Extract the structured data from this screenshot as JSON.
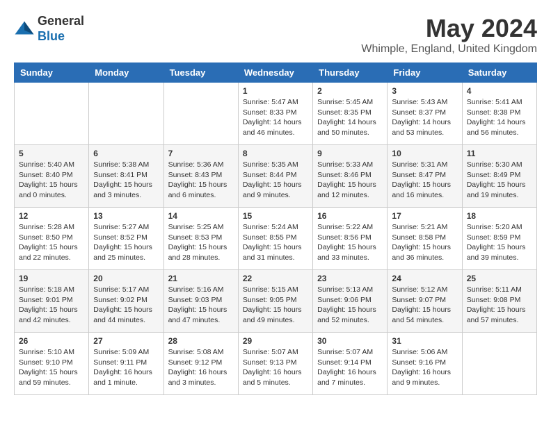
{
  "header": {
    "logo_general": "General",
    "logo_blue": "Blue",
    "month_title": "May 2024",
    "location": "Whimple, England, United Kingdom"
  },
  "days_of_week": [
    "Sunday",
    "Monday",
    "Tuesday",
    "Wednesday",
    "Thursday",
    "Friday",
    "Saturday"
  ],
  "weeks": [
    [
      {
        "day": "",
        "info": ""
      },
      {
        "day": "",
        "info": ""
      },
      {
        "day": "",
        "info": ""
      },
      {
        "day": "1",
        "info": "Sunrise: 5:47 AM\nSunset: 8:33 PM\nDaylight: 14 hours\nand 46 minutes."
      },
      {
        "day": "2",
        "info": "Sunrise: 5:45 AM\nSunset: 8:35 PM\nDaylight: 14 hours\nand 50 minutes."
      },
      {
        "day": "3",
        "info": "Sunrise: 5:43 AM\nSunset: 8:37 PM\nDaylight: 14 hours\nand 53 minutes."
      },
      {
        "day": "4",
        "info": "Sunrise: 5:41 AM\nSunset: 8:38 PM\nDaylight: 14 hours\nand 56 minutes."
      }
    ],
    [
      {
        "day": "5",
        "info": "Sunrise: 5:40 AM\nSunset: 8:40 PM\nDaylight: 15 hours\nand 0 minutes."
      },
      {
        "day": "6",
        "info": "Sunrise: 5:38 AM\nSunset: 8:41 PM\nDaylight: 15 hours\nand 3 minutes."
      },
      {
        "day": "7",
        "info": "Sunrise: 5:36 AM\nSunset: 8:43 PM\nDaylight: 15 hours\nand 6 minutes."
      },
      {
        "day": "8",
        "info": "Sunrise: 5:35 AM\nSunset: 8:44 PM\nDaylight: 15 hours\nand 9 minutes."
      },
      {
        "day": "9",
        "info": "Sunrise: 5:33 AM\nSunset: 8:46 PM\nDaylight: 15 hours\nand 12 minutes."
      },
      {
        "day": "10",
        "info": "Sunrise: 5:31 AM\nSunset: 8:47 PM\nDaylight: 15 hours\nand 16 minutes."
      },
      {
        "day": "11",
        "info": "Sunrise: 5:30 AM\nSunset: 8:49 PM\nDaylight: 15 hours\nand 19 minutes."
      }
    ],
    [
      {
        "day": "12",
        "info": "Sunrise: 5:28 AM\nSunset: 8:50 PM\nDaylight: 15 hours\nand 22 minutes."
      },
      {
        "day": "13",
        "info": "Sunrise: 5:27 AM\nSunset: 8:52 PM\nDaylight: 15 hours\nand 25 minutes."
      },
      {
        "day": "14",
        "info": "Sunrise: 5:25 AM\nSunset: 8:53 PM\nDaylight: 15 hours\nand 28 minutes."
      },
      {
        "day": "15",
        "info": "Sunrise: 5:24 AM\nSunset: 8:55 PM\nDaylight: 15 hours\nand 31 minutes."
      },
      {
        "day": "16",
        "info": "Sunrise: 5:22 AM\nSunset: 8:56 PM\nDaylight: 15 hours\nand 33 minutes."
      },
      {
        "day": "17",
        "info": "Sunrise: 5:21 AM\nSunset: 8:58 PM\nDaylight: 15 hours\nand 36 minutes."
      },
      {
        "day": "18",
        "info": "Sunrise: 5:20 AM\nSunset: 8:59 PM\nDaylight: 15 hours\nand 39 minutes."
      }
    ],
    [
      {
        "day": "19",
        "info": "Sunrise: 5:18 AM\nSunset: 9:01 PM\nDaylight: 15 hours\nand 42 minutes."
      },
      {
        "day": "20",
        "info": "Sunrise: 5:17 AM\nSunset: 9:02 PM\nDaylight: 15 hours\nand 44 minutes."
      },
      {
        "day": "21",
        "info": "Sunrise: 5:16 AM\nSunset: 9:03 PM\nDaylight: 15 hours\nand 47 minutes."
      },
      {
        "day": "22",
        "info": "Sunrise: 5:15 AM\nSunset: 9:05 PM\nDaylight: 15 hours\nand 49 minutes."
      },
      {
        "day": "23",
        "info": "Sunrise: 5:13 AM\nSunset: 9:06 PM\nDaylight: 15 hours\nand 52 minutes."
      },
      {
        "day": "24",
        "info": "Sunrise: 5:12 AM\nSunset: 9:07 PM\nDaylight: 15 hours\nand 54 minutes."
      },
      {
        "day": "25",
        "info": "Sunrise: 5:11 AM\nSunset: 9:08 PM\nDaylight: 15 hours\nand 57 minutes."
      }
    ],
    [
      {
        "day": "26",
        "info": "Sunrise: 5:10 AM\nSunset: 9:10 PM\nDaylight: 15 hours\nand 59 minutes."
      },
      {
        "day": "27",
        "info": "Sunrise: 5:09 AM\nSunset: 9:11 PM\nDaylight: 16 hours\nand 1 minute."
      },
      {
        "day": "28",
        "info": "Sunrise: 5:08 AM\nSunset: 9:12 PM\nDaylight: 16 hours\nand 3 minutes."
      },
      {
        "day": "29",
        "info": "Sunrise: 5:07 AM\nSunset: 9:13 PM\nDaylight: 16 hours\nand 5 minutes."
      },
      {
        "day": "30",
        "info": "Sunrise: 5:07 AM\nSunset: 9:14 PM\nDaylight: 16 hours\nand 7 minutes."
      },
      {
        "day": "31",
        "info": "Sunrise: 5:06 AM\nSunset: 9:16 PM\nDaylight: 16 hours\nand 9 minutes."
      },
      {
        "day": "",
        "info": ""
      }
    ]
  ]
}
